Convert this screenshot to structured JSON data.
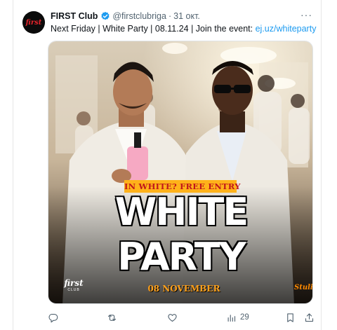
{
  "tweet": {
    "author_name": "FIRST Club",
    "handle": "@firstclubriga",
    "separator": "·",
    "date": "31 окт.",
    "more_label": "···",
    "text_prefix": "Next Friday | White Party | 08.11.24 | Join the event: ",
    "link": "ej.uz/whiteparty"
  },
  "media": {
    "banner_text": "IN WHITE? FREE ENTRY",
    "title_line1": "WHITE",
    "title_line2": "PARTY",
    "date_text": "08 NOVEMBER",
    "logo_line1": "first",
    "logo_line2": "CLUB",
    "studio_mark": "Stuli",
    "avatar_text": "first"
  },
  "actions": {
    "reply_icon": "reply-icon",
    "retweet_icon": "retweet-icon",
    "like_icon": "like-icon",
    "views_icon": "views-icon",
    "views_count": "29",
    "bookmark_icon": "bookmark-icon",
    "share_icon": "share-icon"
  },
  "colors": {
    "link": "#1d9bf0",
    "verified": "#1d9bf0",
    "banner_bg": "#ffb21a",
    "banner_text": "#c0161b",
    "date_text": "#ffa01a",
    "secondary_text": "#536471"
  }
}
